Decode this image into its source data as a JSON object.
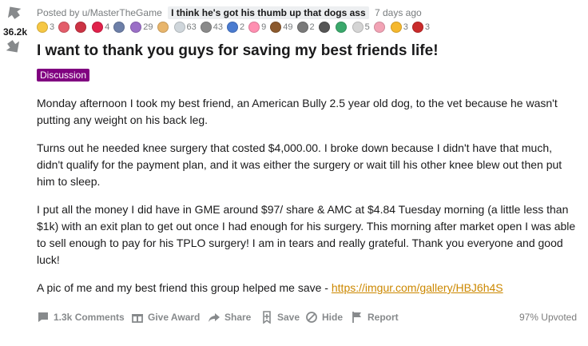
{
  "vote": {
    "score": "36.2k"
  },
  "meta": {
    "posted_by": "Posted by u/MasterTheGame",
    "user_flair": "I think he's got his thumb up that dogs ass",
    "age": "7 days ago"
  },
  "awards": [
    {
      "icon": "award-badge-icon",
      "color": "#f6c744",
      "count": "3"
    },
    {
      "icon": "award-heart-eyes-icon",
      "color": "#e35d6a",
      "count": ""
    },
    {
      "icon": "award-gift-icon",
      "color": "#cc3344",
      "count": ""
    },
    {
      "icon": "award-heart-icon",
      "color": "#e0214a",
      "count": "4"
    },
    {
      "icon": "award-rocket-icon",
      "color": "#6d7fa8",
      "count": ""
    },
    {
      "icon": "award-wholesome-icon",
      "color": "#9b6fc7",
      "count": "29"
    },
    {
      "icon": "award-thumbsup-icon",
      "color": "#e8b56b",
      "count": ""
    },
    {
      "icon": "award-face-icon",
      "color": "#cfd6db",
      "count": "63"
    },
    {
      "icon": "award-coin-icon",
      "color": "#8a8a8a",
      "count": "43"
    },
    {
      "icon": "award-diamond-hands-icon",
      "color": "#4a7bd0",
      "count": "2"
    },
    {
      "icon": "award-love-icon",
      "color": "#ff8fb1",
      "count": "9"
    },
    {
      "icon": "award-bear-icon",
      "color": "#8c5a2e",
      "count": "49"
    },
    {
      "icon": "award-ape-icon",
      "color": "#7a7a7a",
      "count": "2"
    },
    {
      "icon": "award-chef-icon",
      "color": "#555555",
      "count": ""
    },
    {
      "icon": "award-mushroom-icon",
      "color": "#3aa86b",
      "count": ""
    },
    {
      "icon": "award-cow-icon",
      "color": "#d5d5d5",
      "count": "5"
    },
    {
      "icon": "award-hug-icon",
      "color": "#f2a3b5",
      "count": ""
    },
    {
      "icon": "award-sun-icon",
      "color": "#f5b82e",
      "count": "3"
    },
    {
      "icon": "award-dalmatian-icon",
      "color": "#c92b2b",
      "count": "3"
    }
  ],
  "title": "I want to thank you guys for saving my best friends life!",
  "post_flair": "Discussion",
  "body": {
    "p1": "Monday afternoon I took my best friend, an American Bully 2.5 year old dog, to the vet because he wasn't putting any weight on his back leg.",
    "p2": "Turns out he needed knee surgery that costed $4,000.00. I broke down because I didn't have that much, didn't qualify for the payment plan, and it was either the surgery or wait till his other knee blew out then put him to sleep.",
    "p3": "I put all the money I did have in GME around $97/ share & AMC at $4.84 Tuesday morning (a little less than $1k) with an exit plan to get out once I had enough for his surgery. This morning after market open I was able to sell enough to pay for his TPLO surgery! I am in tears and really grateful. Thank you everyone and good luck!",
    "p4_text": "A pic of me and my best friend this group helped me save - ",
    "p4_link": "https://imgur.com/gallery/HBJ6h4S"
  },
  "footer": {
    "comments": "1.3k Comments",
    "give_award": "Give Award",
    "share": "Share",
    "save": "Save",
    "hide": "Hide",
    "report": "Report",
    "upvoted": "97% Upvoted"
  },
  "colors": {
    "flair_bg": "#800080",
    "link": "#cc8800",
    "muted": "#878a8c"
  }
}
